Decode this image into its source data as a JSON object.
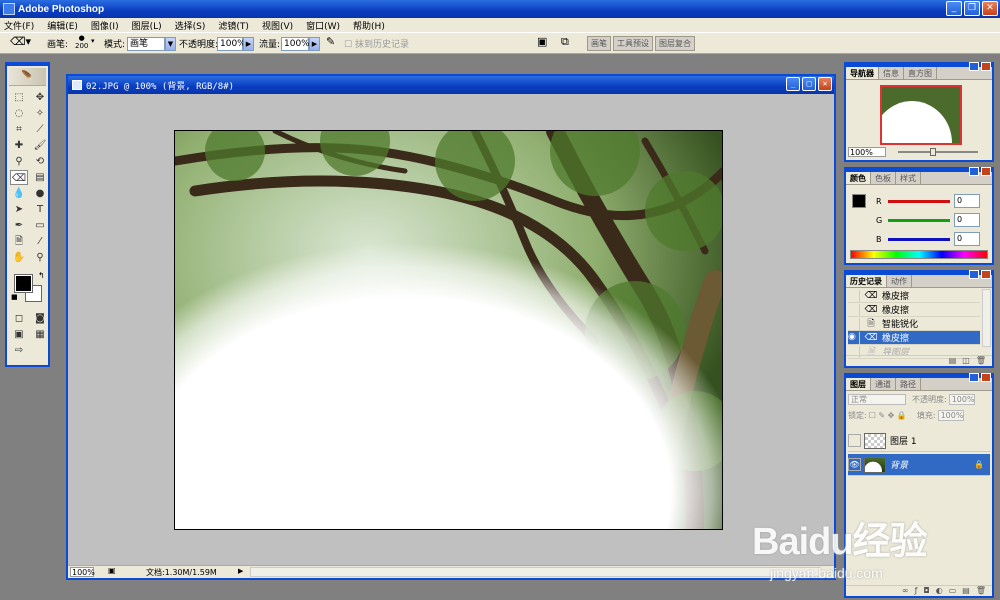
{
  "app": {
    "title": "Adobe Photoshop"
  },
  "menu": [
    "文件(F)",
    "编辑(E)",
    "图像(I)",
    "图层(L)",
    "选择(S)",
    "滤镜(T)",
    "视图(V)",
    "窗口(W)",
    "帮助(H)"
  ],
  "options": {
    "brush_label": "画笔:",
    "brush_size": "200",
    "mode_label": "模式:",
    "mode_value": "画笔",
    "opacity_label": "不透明度:",
    "opacity_value": "100%",
    "flow_label": "流量:",
    "flow_value": "100%",
    "erase_history_label": "抹到历史记录",
    "well_tabs": [
      "画笔",
      "工具预设",
      "图层复合"
    ]
  },
  "document": {
    "title": "02.JPG @ 100% (背景, RGB/8#)",
    "zoom": "100%",
    "doc_info": "文档:1.30M/1.59M"
  },
  "navigator": {
    "tabs": [
      "导航器",
      "信息",
      "直方图"
    ],
    "zoom": "100%"
  },
  "color_panel": {
    "tabs": [
      "颜色",
      "色板",
      "样式"
    ],
    "channels": [
      {
        "label": "R",
        "value": "0",
        "color": "#d01010"
      },
      {
        "label": "G",
        "value": "0",
        "color": "#10a010"
      },
      {
        "label": "B",
        "value": "0",
        "color": "#1010c0"
      }
    ]
  },
  "history_panel": {
    "tabs": [
      "历史记录",
      "动作"
    ],
    "items": [
      {
        "label": "橡皮擦",
        "icon": "eraser-icon",
        "state": "normal"
      },
      {
        "label": "橡皮擦",
        "icon": "eraser-icon",
        "state": "normal"
      },
      {
        "label": "智能锐化",
        "icon": "document-icon",
        "state": "normal"
      },
      {
        "label": "橡皮擦",
        "icon": "eraser-icon",
        "state": "selected"
      },
      {
        "label": "导图层",
        "icon": "document-icon",
        "state": "ghost"
      }
    ]
  },
  "layers_panel": {
    "tabs": [
      "图层",
      "通道",
      "路径"
    ],
    "blend_mode": "正常",
    "opacity_label": "不透明度:",
    "opacity_value": "100%",
    "lock_label": "锁定:",
    "fill_label": "填充:",
    "fill_value": "100%",
    "layers": [
      {
        "name": "图层 1",
        "visible": false,
        "selected": false
      },
      {
        "name": "背景",
        "visible": true,
        "selected": true
      }
    ]
  },
  "watermark": {
    "main": "Baidu经验",
    "sub": "jingyan.baidu.com"
  },
  "colors": {
    "title_bar": "#0a3cc0",
    "panel_bg": "#ece9d8",
    "selection": "#316ac5",
    "workspace": "#808080"
  }
}
